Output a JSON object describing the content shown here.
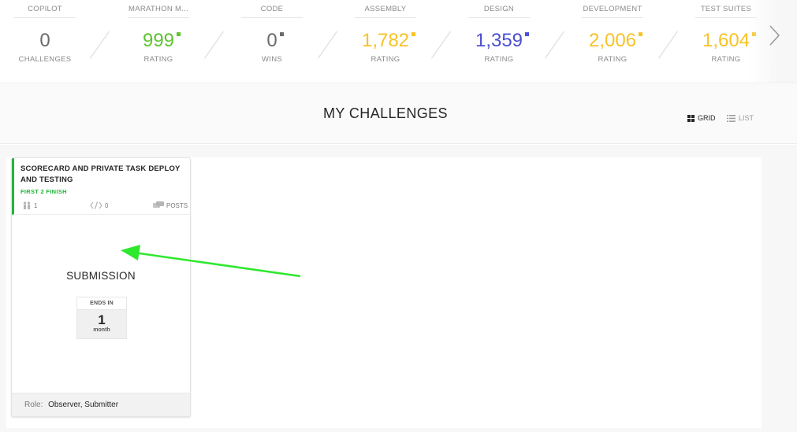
{
  "stats": [
    {
      "title": "COPILOT",
      "value": "0",
      "label": "CHALLENGES",
      "color": "#6b6b6b",
      "dot": false
    },
    {
      "title": "MARATHON M...",
      "value": "999",
      "label": "RATING",
      "color": "#5fc331",
      "dot": true
    },
    {
      "title": "CODE",
      "value": "0",
      "label": "WINS",
      "color": "#6b6b6b",
      "dot": true
    },
    {
      "title": "ASSEMBLY",
      "value": "1,782",
      "label": "RATING",
      "color": "#f7c325",
      "dot": true
    },
    {
      "title": "DESIGN",
      "value": "1,359",
      "label": "RATING",
      "color": "#4c50d3",
      "dot": true
    },
    {
      "title": "DEVELOPMENT",
      "value": "2,006",
      "label": "RATING",
      "color": "#f7c325",
      "dot": true
    },
    {
      "title": "TEST SUITES",
      "value": "1,604",
      "label": "RATING",
      "color": "#f7c325",
      "dot": true
    }
  ],
  "header": {
    "title": "MY CHALLENGES",
    "grid_label": "GRID",
    "list_label": "LIST"
  },
  "card": {
    "title": "SCORECARD AND PRIVATE TASK DEPLOY AND TESTING",
    "track": "FIRST 2 FINISH",
    "registrants": "1",
    "submissions": "0",
    "posts_label": "POSTS",
    "phase": "SUBMISSION",
    "ends_label": "ENDS IN",
    "ends_value": "1",
    "ends_unit": "month",
    "role_label": "Role:",
    "role_value": "Observer, Submitter"
  },
  "colors": {
    "track_green": "#21b43a",
    "annotation_arrow": "#2ee82e"
  },
  "icons": {
    "nav": "chevron-right-icon",
    "grid": "grid-view-icon",
    "list": "list-view-icon",
    "registrants": "users-icon",
    "submissions": "code-icon",
    "posts": "chat-bubbles-icon"
  }
}
